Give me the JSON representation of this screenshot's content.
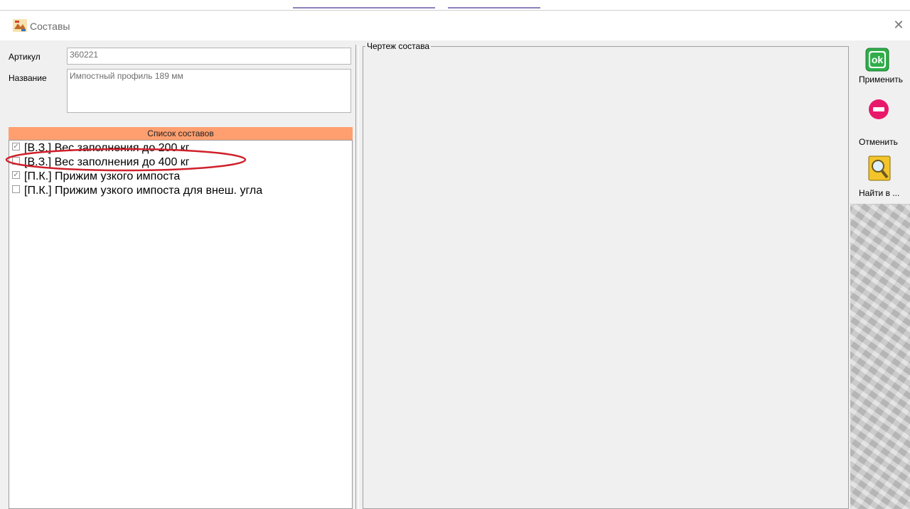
{
  "window": {
    "title": "Составы",
    "close_glyph": "✕"
  },
  "fields": {
    "article_label": "Артикул",
    "article_value": "360221",
    "name_label": "Название",
    "name_value": "Импостный профиль 189 мм"
  },
  "list": {
    "header": "Список составов",
    "items": [
      {
        "label": "[В.З.] Вес заполнения до 200 кг",
        "checked": true
      },
      {
        "label": "[В.З.] Вес заполнения до 400 кг",
        "checked": false
      },
      {
        "label": "[П.К.] Прижим узкого импоста",
        "checked": true
      },
      {
        "label": "[П.К.] Прижим узкого импоста для внеш. угла",
        "checked": false
      }
    ]
  },
  "drawing": {
    "title": "Чертеж состава"
  },
  "toolbar": {
    "apply": {
      "label": "Применить",
      "icon": "ok-icon",
      "icon_text": "ok"
    },
    "cancel": {
      "label": "Отменить",
      "icon": "no-entry-icon"
    },
    "find": {
      "label": "Найти в ...",
      "icon": "magnifier-icon"
    }
  },
  "colors": {
    "list_header_bg": "#ff9f70",
    "annotation_ellipse": "#d0202a",
    "ok_green": "#2fae4a",
    "cancel_pink": "#e8196b"
  }
}
